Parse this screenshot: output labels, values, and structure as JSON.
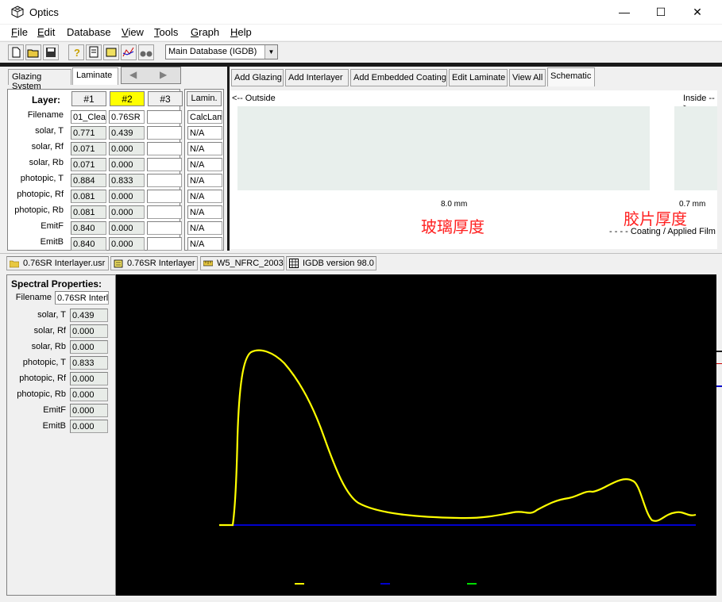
{
  "window": {
    "title": "Optics",
    "minimize": "—",
    "maximize": "☐",
    "close": "✕"
  },
  "menu": [
    "File",
    "Edit",
    "Database",
    "View",
    "Tools",
    "Graph",
    "Help"
  ],
  "menu_hotkeys": [
    "F",
    "E",
    "",
    "V",
    "T",
    "G",
    "H"
  ],
  "toolbar": {
    "database_select": "Main Database (IGDB)"
  },
  "left_tabs": {
    "glazing": "Glazing System",
    "laminate": "Laminate"
  },
  "nav": {
    "back": "◀",
    "forward": "▶"
  },
  "layer_table": {
    "header_label": "Layer:",
    "layers": [
      "#1",
      "#2",
      "#3"
    ],
    "row_labels": [
      "Filename",
      "solar, T",
      "solar, Rf",
      "solar, Rb",
      "photopic, T",
      "photopic, Rf",
      "photopic, Rb",
      "EmitF",
      "EmitB"
    ],
    "col1": [
      "01_Clea",
      "0.771",
      "0.071",
      "0.071",
      "0.884",
      "0.081",
      "0.081",
      "0.840",
      "0.840"
    ],
    "col2": [
      "0.76SR",
      "0.439",
      "0.000",
      "0.000",
      "0.833",
      "0.000",
      "0.000",
      "0.000",
      "0.000"
    ],
    "col3": [
      "",
      "",
      "",
      "",
      "",
      "",
      "",
      "",
      ""
    ]
  },
  "lamin": {
    "header": "Lamin.",
    "values": [
      "CalcLam",
      "N/A",
      "N/A",
      "N/A",
      "N/A",
      "N/A",
      "N/A",
      "N/A",
      "N/A"
    ]
  },
  "schematic_tabs": [
    "Add Glazing",
    "Add Interlayer",
    "Add Embedded Coating",
    "Edit Laminate",
    "View All",
    "Schematic"
  ],
  "schematic": {
    "outside": "<-- Outside",
    "inside": "Inside -->",
    "glass_thickness": "8.0 mm",
    "film_thickness": "0.7 mm",
    "glass_annotation": "玻璃厚度",
    "film_annotation": "胶片厚度",
    "legend": "- - - -  Coating / Applied Film"
  },
  "status": [
    {
      "label": "0.76SR Interlayer.usr",
      "icon": "folder-icon"
    },
    {
      "label": "0.76SR Interlayer",
      "icon": "layer-icon"
    },
    {
      "label": "W5_NFRC_2003",
      "icon": "ruler-icon"
    },
    {
      "label": "IGDB version 98.0",
      "icon": "grid-icon"
    }
  ],
  "spectral": {
    "title": "Spectral Properties:",
    "filename_label": "Filename",
    "filename_value": "0.76SR Interl",
    "row_labels": [
      "solar, T",
      "solar, Rf",
      "solar, Rb",
      "photopic, T",
      "photopic, Rf",
      "photopic, Rb",
      "EmitF",
      "EmitB"
    ],
    "values": [
      "0.439",
      "0.000",
      "0.000",
      "0.833",
      "0.000",
      "0.000",
      "0.000",
      "0.000"
    ]
  },
  "colors": {
    "highlight": "#ffff00",
    "curve": "#ffff00",
    "baseline": "#0000cc",
    "annotation": "#ff2020"
  }
}
